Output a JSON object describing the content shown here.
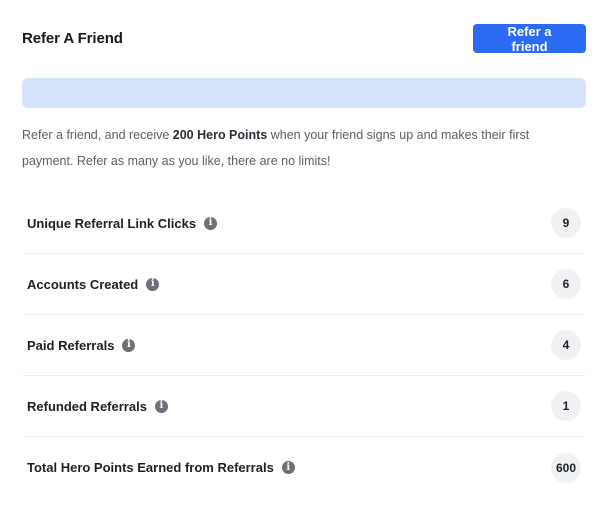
{
  "header": {
    "title": "Refer A Friend",
    "refer_button_label": "Refer a friend"
  },
  "referral_link": {
    "value": ""
  },
  "description": {
    "prefix": "Refer a friend, and receive ",
    "highlight": "200 Hero Points",
    "suffix": " when your friend signs up and makes their first payment. Refer as many as you like, there are no limits!"
  },
  "stats": [
    {
      "label": "Unique Referral Link Clicks",
      "value": "9"
    },
    {
      "label": "Accounts Created",
      "value": "6"
    },
    {
      "label": "Paid Referrals",
      "value": "4"
    },
    {
      "label": "Refunded Referrals",
      "value": "1"
    },
    {
      "label": "Total Hero Points Earned from Referrals",
      "value": "600"
    }
  ],
  "icons": {
    "info": "info-icon"
  },
  "colors": {
    "primary_button": "#2a6bf2",
    "link_box_bg": "#d6e4fb",
    "badge_bg": "#f0f1f3",
    "info_icon": "#6c7178"
  }
}
